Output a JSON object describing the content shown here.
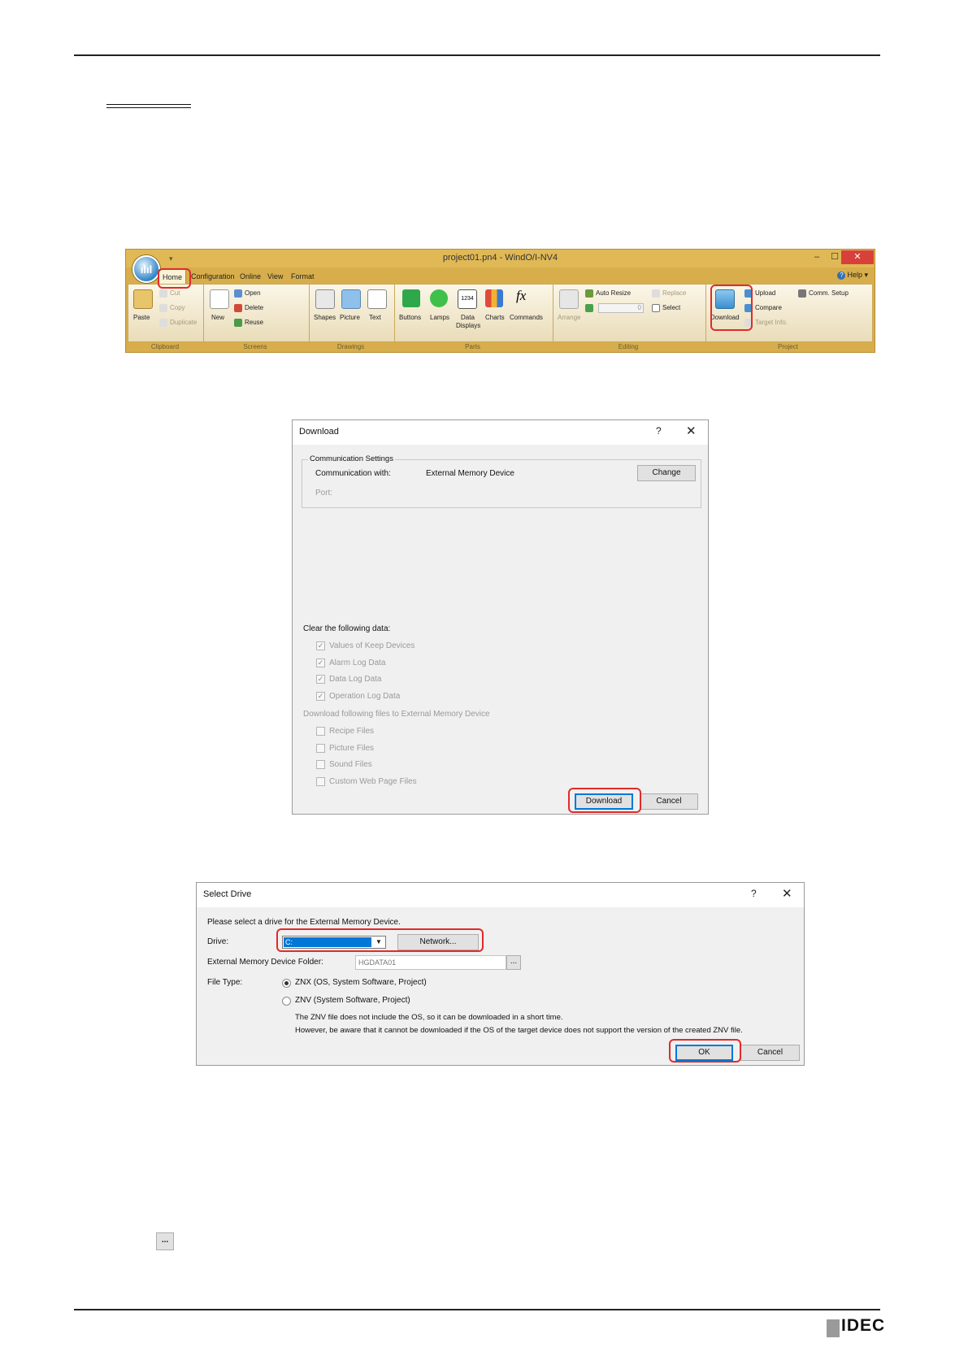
{
  "ribbon": {
    "title": "project01.pn4 - WindO/I-NV4",
    "app_icon": "app-orb-icon",
    "window_controls": [
      "–",
      "☐",
      "✕"
    ],
    "tabs": [
      "Home",
      "Configuration",
      "Online",
      "View",
      "Format"
    ],
    "help": "Help",
    "groups": {
      "clipboard": {
        "label": "Clipboard",
        "paste": "Paste",
        "cut": "Cut",
        "copy": "Copy",
        "duplicate": "Duplicate"
      },
      "screens": {
        "label": "Screens",
        "new": "New",
        "open": "Open",
        "delete": "Delete",
        "reuse": "Reuse"
      },
      "drawings": {
        "label": "Drawings",
        "shapes": "Shapes",
        "picture": "Picture",
        "text": "Text"
      },
      "parts": {
        "label": "Parts",
        "buttons": "Buttons",
        "lamps": "Lamps",
        "data_displays_1": "Data",
        "data_displays_2": "Displays",
        "data_icon_text": "1234",
        "charts": "Charts",
        "commands": "Commands",
        "fx": "fx"
      },
      "editing": {
        "label": "Editing",
        "arrange": "Arrange",
        "auto_resize": "Auto Resize",
        "spin_value": "0",
        "replace": "Replace",
        "select": "Select"
      },
      "project": {
        "label": "Project",
        "download": "Download",
        "upload": "Upload",
        "compare": "Compare",
        "target_info": "Target Info.",
        "comm_setup": "Comm. Setup"
      }
    }
  },
  "download_dialog": {
    "title": "Download",
    "help": "?",
    "close": "✕",
    "comm_settings": "Communication Settings",
    "comm_with_label": "Communication with:",
    "comm_with_value": "External Memory Device",
    "change": "Change",
    "port_label": "Port:",
    "clear_label": "Clear the following data:",
    "clear_items": [
      "Values of Keep Devices",
      "Alarm Log Data",
      "Data Log Data",
      "Operation Log Data"
    ],
    "files_label": "Download following files to External Memory Device",
    "file_items": [
      "Recipe Files",
      "Picture Files",
      "Sound Files",
      "Custom Web Page Files"
    ],
    "download_button": "Download",
    "cancel_button": "Cancel"
  },
  "select_drive_dialog": {
    "title": "Select Drive",
    "help": "?",
    "close": "✕",
    "prompt": "Please select a drive for the External Memory Device.",
    "drive_label": "Drive:",
    "drive_value": "C:",
    "network_button": "Network...",
    "folder_label": "External Memory Device Folder:",
    "folder_value": "HGDATA01",
    "browse_button": "...",
    "file_type_label": "File Type:",
    "option_znx": "ZNX (OS, System Software, Project)",
    "option_znv": "ZNV (System Software, Project)",
    "note_1": "The ZNV file does not include the OS, so it can be downloaded in a short time.",
    "note_2": "However, be aware that it cannot be downloaded if the OS of the target device does not support the version of the created ZNV file.",
    "ok_button": "OK",
    "cancel_button": "Cancel"
  },
  "standalone_browse_button": "...",
  "footer": {
    "logo": "IDEC"
  }
}
